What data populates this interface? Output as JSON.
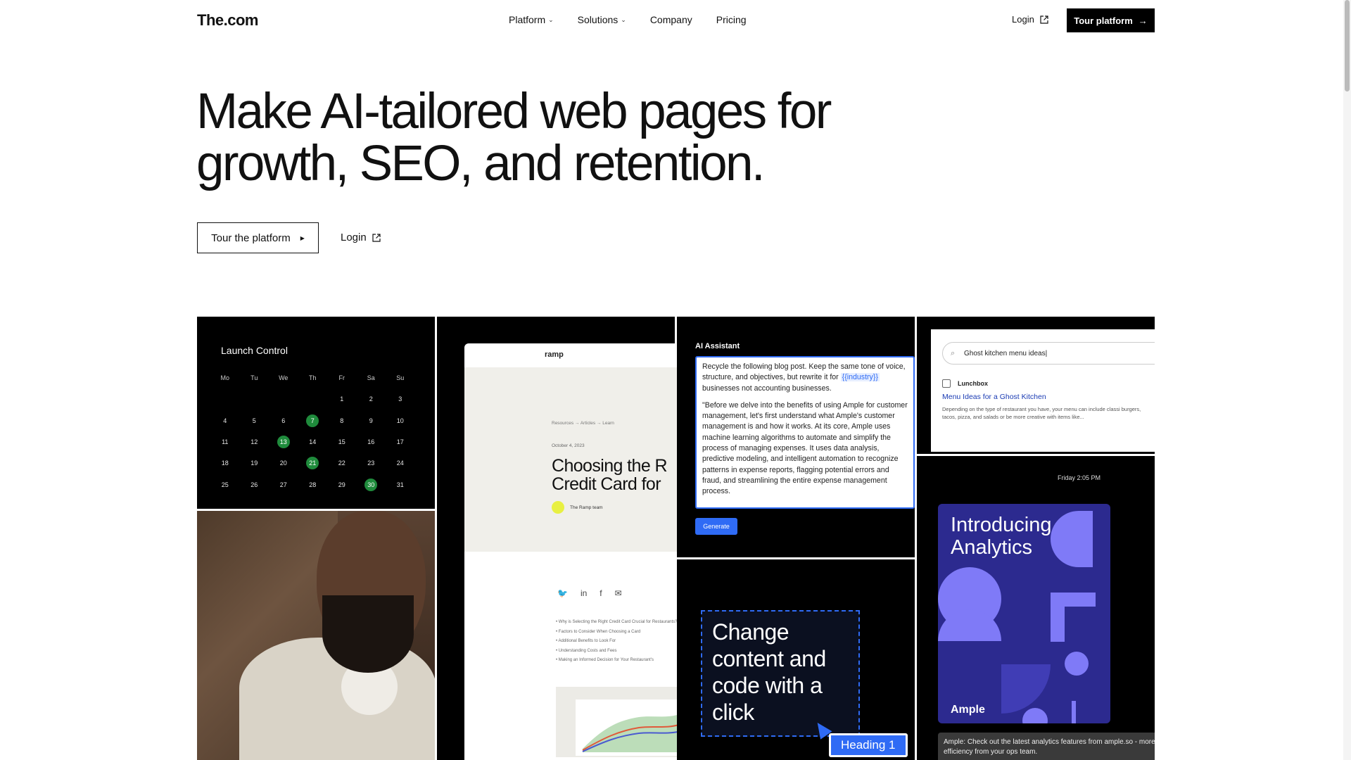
{
  "nav": {
    "logo": "The.com",
    "links": [
      {
        "label": "Platform",
        "has_dropdown": true
      },
      {
        "label": "Solutions",
        "has_dropdown": true
      },
      {
        "label": "Company",
        "has_dropdown": false
      },
      {
        "label": "Pricing",
        "has_dropdown": false
      }
    ],
    "login": "Login",
    "cta": "Tour platform"
  },
  "hero": {
    "title_line1": "Make AI-tailored web pages for",
    "title_line2": "growth, SEO, and retention.",
    "primary_button": "Tour the platform",
    "secondary_button": "Login"
  },
  "calendar": {
    "title": "Launch Control",
    "weekdays": [
      "Mo",
      "Tu",
      "We",
      "Th",
      "Fr",
      "Sa",
      "Su"
    ],
    "highlighted": [
      7,
      13,
      21,
      30
    ]
  },
  "article": {
    "brand": "ramp",
    "breadcrumb": "Resources  →  Articles  →  Learn",
    "date": "October 4, 2023",
    "heading": "Choosing the R Credit Card for",
    "heading_l1": "Choosing the R",
    "heading_l2": "Credit Card for",
    "author": "The Ramp team",
    "toc": [
      "Why is Selecting the Right Credit Card Crucial for Restaurants?",
      "Factors to Consider When Choosing a Card",
      "Additional Benefits to Look For",
      "Understanding Costs and Fees",
      "Making an Informed Decision for Your Restaurant's"
    ]
  },
  "ai_assistant": {
    "title": "AI Assistant",
    "prompt_pre": "Recycle the following blog post.  Keep the same tone of voice, structure, and objectives, but rewrite it for",
    "prompt_tag": "{{industry}}",
    "prompt_post": "businesses not accounting businesses.",
    "body": "\"Before we delve into the benefits of using Ample for customer management, let's first understand what Ample's customer management is and how it works. At its core, Ample uses machine learning algorithms to automate and simplify the process of managing expenses. It uses data analysis, predictive modeling, and intelligent automation to recognize patterns in expense reports, flagging potential errors and fraud, and streamlining the entire expense management process.",
    "button": "Generate"
  },
  "change_content": {
    "text": "Change content and code with a click",
    "badge": "Heading 1"
  },
  "search_panel": {
    "query": "Ghost kitchen menu ideas|",
    "result_source": "Lunchbox",
    "result_title": "Menu Ideas for a Ghost Kitchen",
    "result_desc": "Depending on the type of restaurant you have, your menu can include classi burgers, tacos, pizza, and salads or be more creative with items like..."
  },
  "analytics": {
    "time": "Friday 2:05 PM",
    "title": "Introducing Analytics",
    "brand": "Ample",
    "toast": "Ample: Check out the latest analytics features from ample.so - more efficiency from your ops team.",
    "card_color": "#2c2a8f",
    "shape_color": "#7f7af7"
  },
  "colors": {
    "accent_blue": "#2f6bf5",
    "calendar_highlight": "#1f8b3c"
  }
}
